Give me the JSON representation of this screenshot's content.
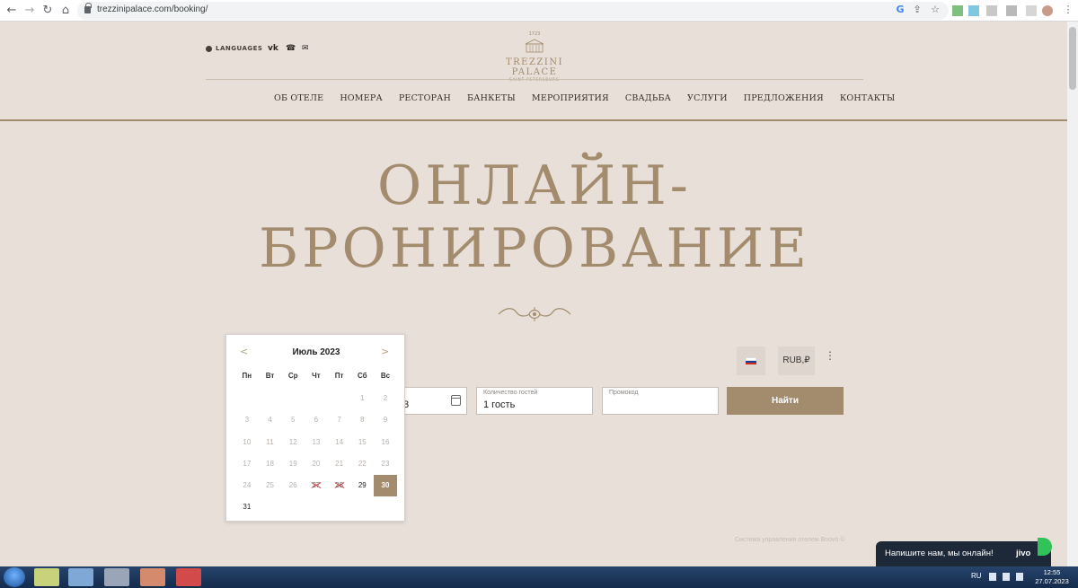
{
  "browser": {
    "url": "trezzinipalace.com/booking/",
    "back_icon": "←",
    "forward_icon": "→",
    "reload_icon": "↻",
    "home_icon": "⌂",
    "star_icon": "☆",
    "share_icon": "⇪",
    "menu_icon": "⋮"
  },
  "header": {
    "languages_label": "LANGUAGES",
    "social_icons": [
      "vk-icon",
      "phone-icon",
      "mail-icon"
    ],
    "social_glyphs": [
      "vk",
      "☎",
      "✉"
    ],
    "logo": {
      "year": "1723",
      "name": "TREZZINI PALACE",
      "subtitle": "SAINT-PETERSBURG"
    },
    "nav": [
      "ОБ ОТЕЛЕ",
      "НОМЕРА",
      "РЕСТОРАН",
      "БАНКЕТЫ",
      "МЕРОПРИЯТИЯ",
      "СВАДЬБА",
      "УСЛУГИ",
      "ПРЕДЛОЖЕНИЯ",
      "КОНТАКТЫ"
    ]
  },
  "hero": {
    "title_line1": "ОНЛАЙН-",
    "title_line2": "БРОНИРОВАНИЕ"
  },
  "booking": {
    "currency": "RUB,₽",
    "more_icon": "⋮",
    "date_value_fragment": "3",
    "guests_label": "Количество гостей",
    "guests_value": "1 гость",
    "promo_label": "Промокод",
    "promo_value": "",
    "find_button": "Найти"
  },
  "calendar": {
    "prev": "<",
    "next": ">",
    "title": "Июль 2023",
    "weekdays": [
      "Пн",
      "Вт",
      "Ср",
      "Чт",
      "Пт",
      "Сб",
      "Вс"
    ],
    "days": [
      {
        "d": "",
        "s": "empty"
      },
      {
        "d": "",
        "s": "empty"
      },
      {
        "d": "",
        "s": "empty"
      },
      {
        "d": "",
        "s": "empty"
      },
      {
        "d": "",
        "s": "empty"
      },
      {
        "d": "1",
        "s": "past"
      },
      {
        "d": "2",
        "s": "past"
      },
      {
        "d": "3",
        "s": "past"
      },
      {
        "d": "4",
        "s": "past"
      },
      {
        "d": "5",
        "s": "past"
      },
      {
        "d": "6",
        "s": "past"
      },
      {
        "d": "7",
        "s": "past"
      },
      {
        "d": "8",
        "s": "past"
      },
      {
        "d": "9",
        "s": "past"
      },
      {
        "d": "10",
        "s": "past"
      },
      {
        "d": "11",
        "s": "past"
      },
      {
        "d": "12",
        "s": "past"
      },
      {
        "d": "13",
        "s": "past"
      },
      {
        "d": "14",
        "s": "past"
      },
      {
        "d": "15",
        "s": "past"
      },
      {
        "d": "16",
        "s": "past"
      },
      {
        "d": "17",
        "s": "past"
      },
      {
        "d": "18",
        "s": "past"
      },
      {
        "d": "19",
        "s": "past"
      },
      {
        "d": "20",
        "s": "past"
      },
      {
        "d": "21",
        "s": "past"
      },
      {
        "d": "22",
        "s": "past"
      },
      {
        "d": "23",
        "s": "past"
      },
      {
        "d": "24",
        "s": "past"
      },
      {
        "d": "25",
        "s": "past"
      },
      {
        "d": "26",
        "s": "past"
      },
      {
        "d": "27",
        "s": "unavailable"
      },
      {
        "d": "28",
        "s": "unavailable"
      },
      {
        "d": "29",
        "s": "available"
      },
      {
        "d": "30",
        "s": "selected"
      },
      {
        "d": "31",
        "s": "available"
      }
    ]
  },
  "footer": {
    "bnovo": "Система управления отелем Bnovo ©"
  },
  "chat": {
    "text": "Напишите нам, мы онлайн!",
    "brand": "jivo"
  },
  "taskbar": {
    "lang": "RU",
    "time": "12:55",
    "date": "27.07.2023"
  },
  "colors": {
    "accent": "#a38b6d",
    "background": "#e8dfd9",
    "chat_bg": "#1d2939",
    "chat_dot": "#31c25a"
  }
}
